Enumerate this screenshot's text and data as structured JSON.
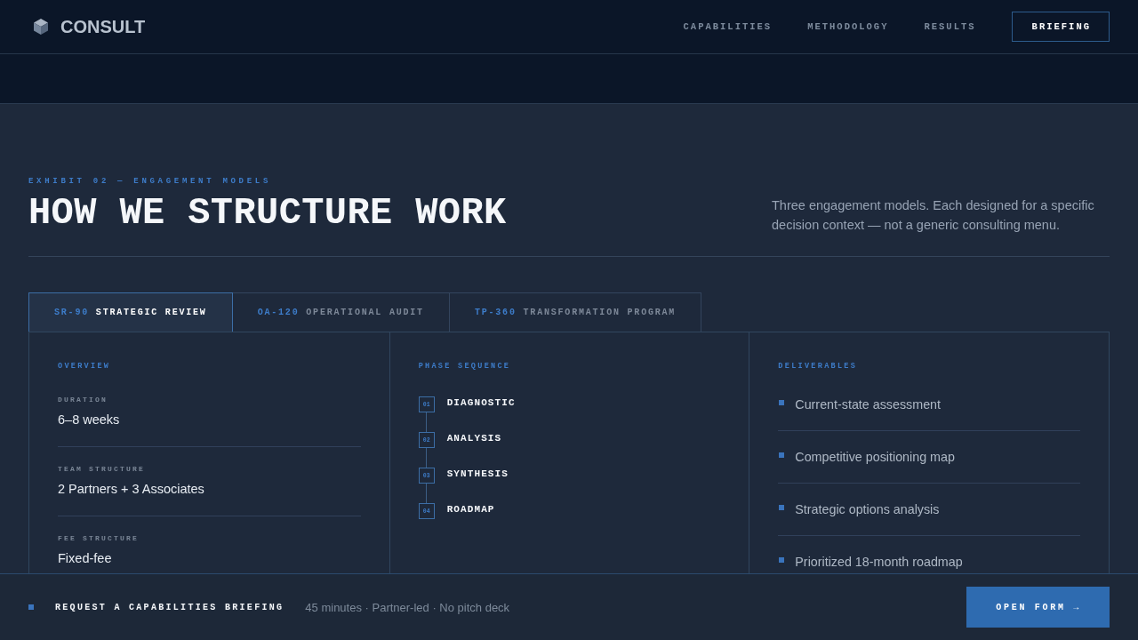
{
  "header": {
    "logo": "CONSULT",
    "nav": [
      {
        "label": "CAPABILITIES",
        "kind": "link"
      },
      {
        "label": "METHODOLOGY",
        "kind": "link"
      },
      {
        "label": "RESULTS",
        "kind": "link"
      },
      {
        "label": "BRIEFING",
        "kind": "button"
      }
    ]
  },
  "intro": {
    "eyebrow": "EXHIBIT 02 — ENGAGEMENT MODELS",
    "title": "HOW WE STRUCTURE WORK",
    "description": "Three engagement models. Each designed for a specific decision context — not a generic consulting menu."
  },
  "tabs": [
    {
      "code": "SR-90",
      "label": "STRATEGIC REVIEW",
      "selected": true
    },
    {
      "code": "OA-120",
      "label": "OPERATIONAL AUDIT",
      "selected": false
    },
    {
      "code": "TP-360",
      "label": "TRANSFORMATION PROGRAM",
      "selected": false
    }
  ],
  "panel": {
    "overview": {
      "heading": "OVERVIEW",
      "fields": [
        {
          "label": "DURATION",
          "value": "6–8 weeks"
        },
        {
          "label": "TEAM STRUCTURE",
          "value": "2 Partners + 3 Associates"
        },
        {
          "label": "FEE STRUCTURE",
          "value": "Fixed-fee"
        }
      ]
    },
    "phases": {
      "heading": "PHASE SEQUENCE",
      "steps": [
        {
          "number": "01",
          "name": "DIAGNOSTIC"
        },
        {
          "number": "02",
          "name": "ANALYSIS"
        },
        {
          "number": "03",
          "name": "SYNTHESIS"
        },
        {
          "number": "04",
          "name": "ROADMAP"
        }
      ]
    },
    "deliverables": {
      "heading": "DELIVERABLES",
      "items": [
        "Current-state assessment",
        "Competitive positioning map",
        "Strategic options analysis",
        "Prioritized 18-month roadmap"
      ]
    }
  },
  "cta_bar": {
    "title": "REQUEST A CAPABILITIES BRIEFING",
    "details": "45 minutes · Partner-led · No pitch deck",
    "button": "OPEN FORM →"
  }
}
